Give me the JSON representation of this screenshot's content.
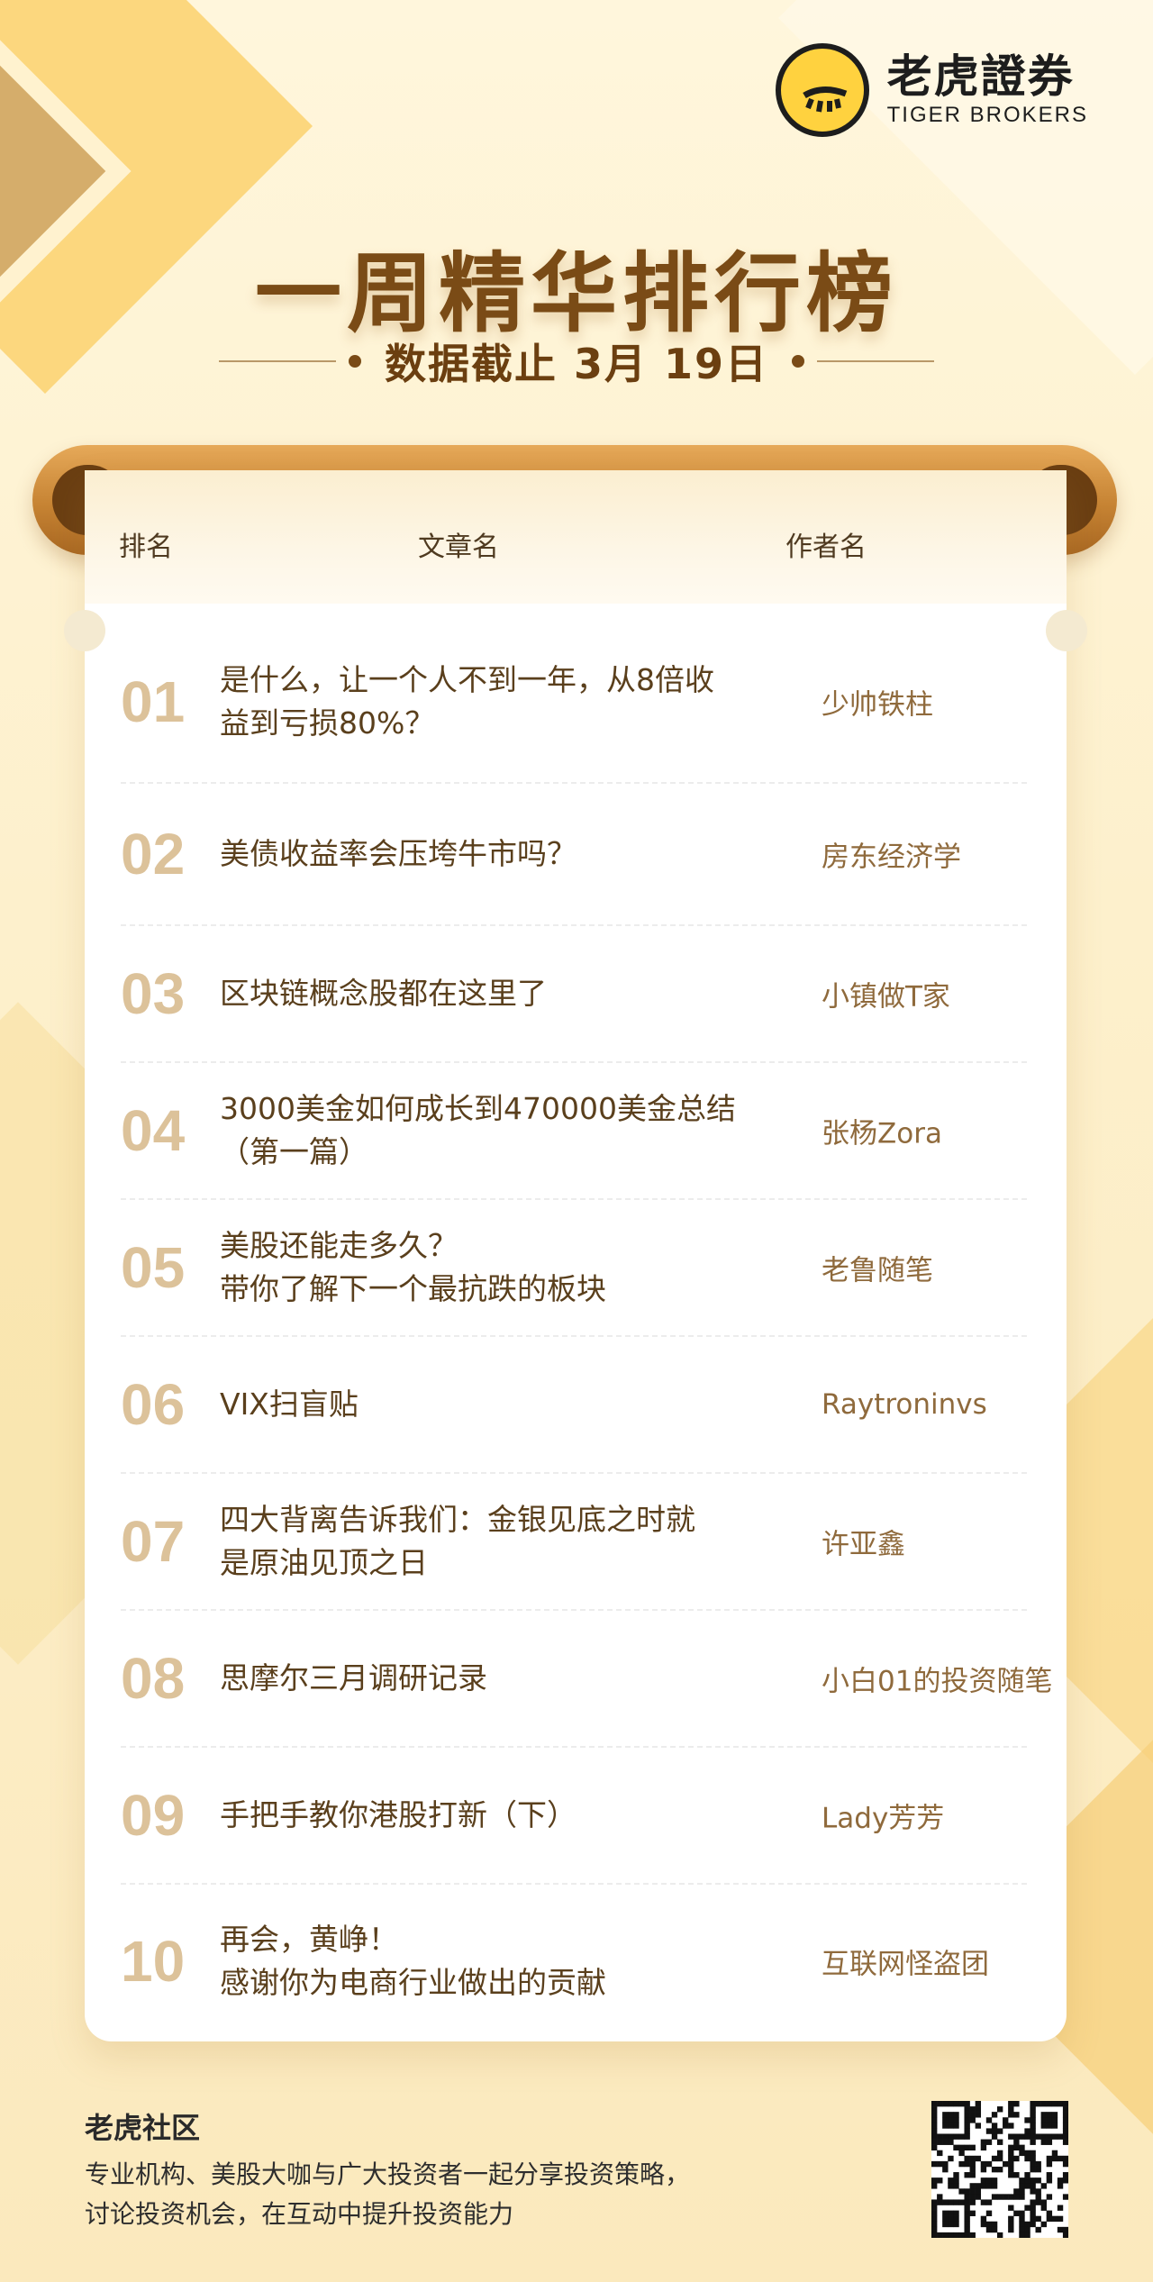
{
  "brand": {
    "name_cn": "老虎證券",
    "name_en": "TIGER BROKERS"
  },
  "title": "一周精华排行榜",
  "subtitle": "数据截止 3月 19日",
  "table": {
    "headers": {
      "rank": "排名",
      "article": "文章名",
      "author": "作者名"
    },
    "rows": [
      {
        "rank": "01",
        "article": "是什么，让一个人不到一年，从8倍收\n益到亏损80%？",
        "author": "少帅铁柱"
      },
      {
        "rank": "02",
        "article": "美债收益率会压垮牛市吗？",
        "author": "房东经济学"
      },
      {
        "rank": "03",
        "article": "区块链概念股都在这里了",
        "author": "小镇做T家"
      },
      {
        "rank": "04",
        "article": "3000美金如何成长到470000美金总结\n（第一篇）",
        "author": "张杨Zora"
      },
      {
        "rank": "05",
        "article": "美股还能走多久？\n带你了解下一个最抗跌的板块",
        "author": "老鲁随笔"
      },
      {
        "rank": "06",
        "article": "VIX扫盲贴",
        "author": "Raytroninvs"
      },
      {
        "rank": "07",
        "article": "四大背离告诉我们：金银见底之时就\n是原油见顶之日",
        "author": "许亚鑫"
      },
      {
        "rank": "08",
        "article": "思摩尔三月调研记录",
        "author": "小白01的投资随笔"
      },
      {
        "rank": "09",
        "article": "手把手教你港股打新（下）",
        "author": "Lady芳芳"
      },
      {
        "rank": "10",
        "article": "再会，黄峥！\n感谢你为电商行业做出的贡献",
        "author": "互联网怪盗团"
      }
    ]
  },
  "footer": {
    "title": "老虎社区",
    "desc": "专业机构、美股大咖与广大投资者一起分享投资策略，\n讨论投资机会，在互动中提升投资能力"
  },
  "icons": {
    "logo": "tiger-logo-icon",
    "qr": "qr-code-icon"
  },
  "colors": {
    "title": "#7a4b16",
    "rank": "#dcc29a",
    "accent": "#ffd23f",
    "background": "#fdf1cf"
  }
}
